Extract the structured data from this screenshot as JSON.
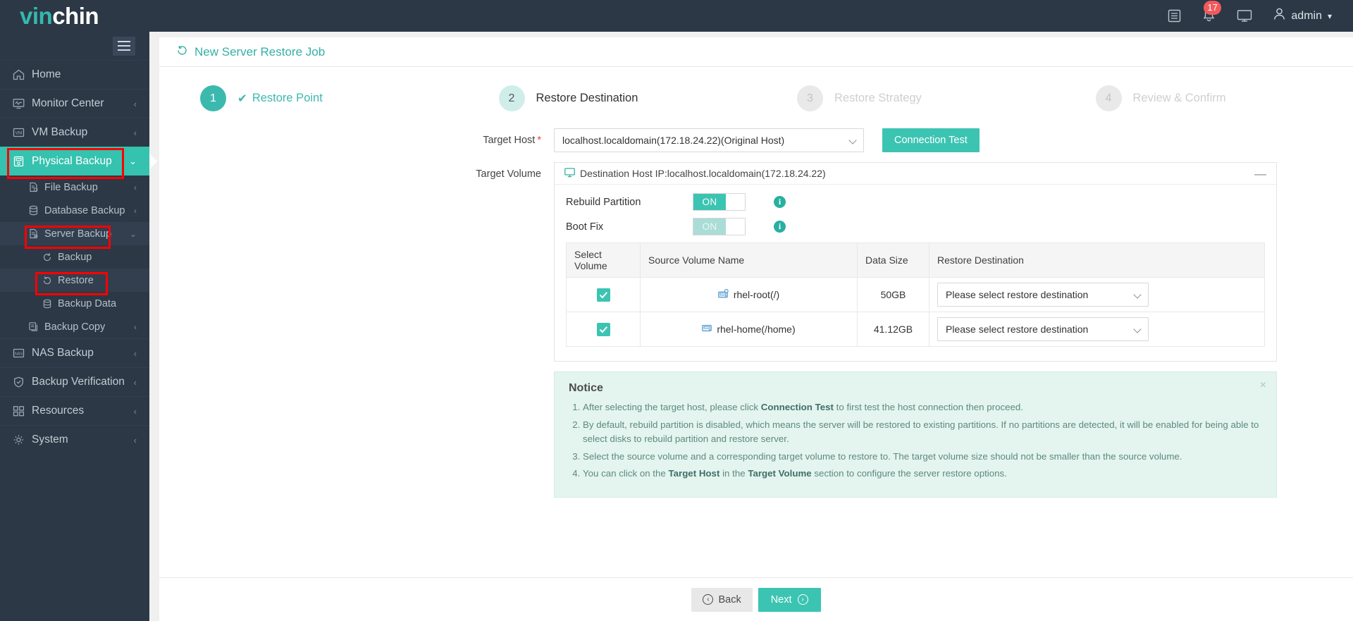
{
  "header": {
    "logo_teal": "vin",
    "logo_white": "chin",
    "notification_count": "17",
    "user_name": "admin",
    "icons": [
      "list-icon",
      "bell-icon",
      "monitor-icon",
      "user-icon"
    ]
  },
  "sidebar": {
    "items": [
      {
        "label": "Home",
        "icon": "home-icon",
        "arrow": ""
      },
      {
        "label": "Monitor Center",
        "icon": "monitor-center-icon",
        "arrow": "‹"
      },
      {
        "label": "VM Backup",
        "icon": "vm-icon",
        "arrow": "‹"
      },
      {
        "label": "Physical Backup",
        "icon": "physical-backup-icon",
        "arrow": "⌄",
        "active": true
      },
      {
        "label": "NAS Backup",
        "icon": "nas-icon",
        "arrow": "‹"
      },
      {
        "label": "Backup Verification",
        "icon": "shield-check-icon",
        "arrow": "‹"
      },
      {
        "label": "Resources",
        "icon": "resources-icon",
        "arrow": "‹"
      },
      {
        "label": "System",
        "icon": "gear-icon",
        "arrow": "‹"
      }
    ],
    "sub_items": [
      {
        "label": "File Backup",
        "icon": "file-backup-icon",
        "arrow": "‹"
      },
      {
        "label": "Database Backup",
        "icon": "database-icon",
        "arrow": "‹"
      },
      {
        "label": "Server Backup",
        "icon": "server-backup-icon",
        "arrow": "⌄",
        "selected": true
      },
      {
        "label": "Backup Copy",
        "icon": "copy-icon",
        "arrow": "‹"
      }
    ],
    "server_backup_children": [
      {
        "label": "Backup",
        "icon": "backup-icon"
      },
      {
        "label": "Restore",
        "icon": "restore-icon",
        "selected": true
      },
      {
        "label": "Backup Data",
        "icon": "backup-data-icon"
      }
    ]
  },
  "page": {
    "title": "New Server Restore Job",
    "title_icon": "restore-icon"
  },
  "steps": [
    {
      "num": "1",
      "label": "Restore Point",
      "state": "done",
      "check": "✔"
    },
    {
      "num": "2",
      "label": "Restore Destination",
      "state": "active"
    },
    {
      "num": "3",
      "label": "Restore Strategy",
      "state": "idle"
    },
    {
      "num": "4",
      "label": "Review & Confirm",
      "state": "idle"
    }
  ],
  "form": {
    "target_host_label": "Target Host",
    "target_host_value": "localhost.localdomain(172.18.24.22)(Original Host)",
    "connection_test_label": "Connection Test",
    "target_volume_label": "Target Volume",
    "panel_header": "Destination Host IP:localhost.localdomain(172.18.24.22)",
    "panel_header_icon": "monitor-icon",
    "collapse_icon": "—",
    "rebuild_partition_label": "Rebuild Partition",
    "rebuild_partition_state": "ON",
    "boot_fix_label": "Boot Fix",
    "boot_fix_state": "ON",
    "info_icon": "i"
  },
  "table": {
    "columns": [
      "Select Volume",
      "Source Volume Name",
      "Data Size",
      "Restore Destination"
    ],
    "rows": [
      {
        "selected": true,
        "name": "rhel-root(/)",
        "icon": "disk-root-icon",
        "size": "50GB",
        "destination": "Please select restore destination"
      },
      {
        "selected": true,
        "name": "rhel-home(/home)",
        "icon": "disk-icon",
        "size": "41.12GB",
        "destination": "Please select restore destination"
      }
    ]
  },
  "notice": {
    "title": "Notice",
    "close_icon": "×",
    "items": [
      {
        "pre": "After selecting the target host, please click ",
        "bold": "Connection Test",
        "post": " to first test the host connection then proceed."
      },
      {
        "pre": "By default, rebuild partition is disabled, which means the server will be restored to existing partitions. If no partitions are detected, it will be enabled for being able to select disks to rebuild partition and restore server.",
        "bold": "",
        "post": ""
      },
      {
        "pre": "Select the source volume and a corresponding target volume to restore to. The target volume size should not be smaller than the source volume.",
        "bold": "",
        "post": ""
      },
      {
        "pre": "You can click on the ",
        "bold": "Target Host",
        "mid": " in the ",
        "bold2": "Target Volume",
        "post": " section to configure the server restore options."
      }
    ]
  },
  "footer": {
    "back_label": "Back",
    "next_label": "Next"
  },
  "colors": {
    "accent_teal": "#3cc4b2",
    "sidebar_bg": "#2c3845",
    "annotation_red": "#ff0000",
    "badge_red": "#f2595c",
    "notice_bg": "#e4f4ef"
  }
}
